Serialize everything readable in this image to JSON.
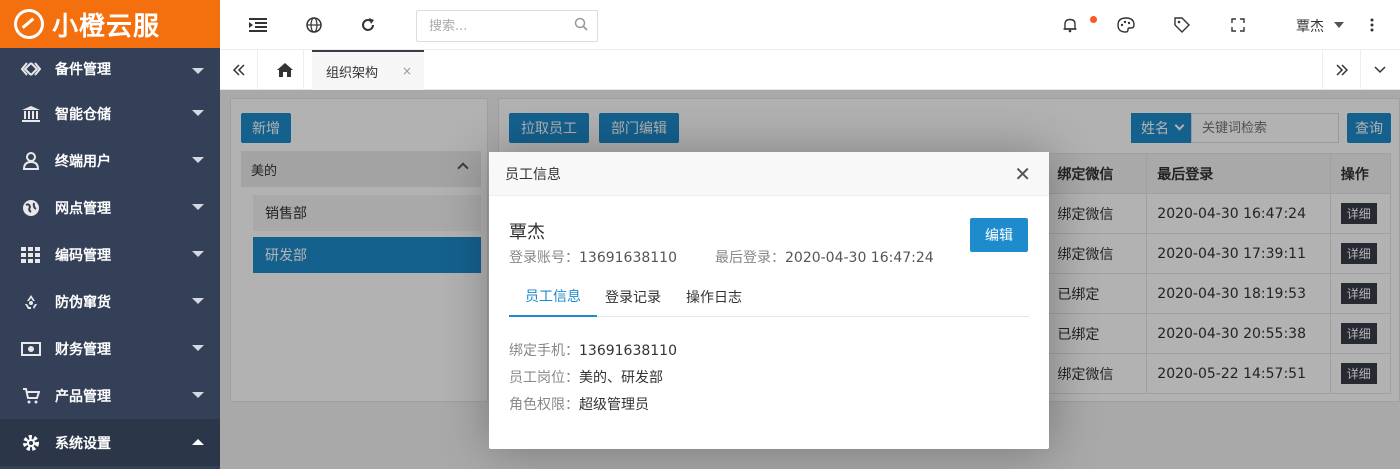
{
  "brand": {
    "name": "小橙云服",
    "color": "#f4700e"
  },
  "sidebar": {
    "items": [
      {
        "label": "备件管理",
        "icon": "arrows-icon",
        "expanded": false
      },
      {
        "label": "智能仓储",
        "icon": "bank-icon",
        "expanded": false
      },
      {
        "label": "终端用户",
        "icon": "user-icon",
        "expanded": false
      },
      {
        "label": "网点管理",
        "icon": "globe-icon",
        "expanded": false
      },
      {
        "label": "编码管理",
        "icon": "grid-icon",
        "expanded": false
      },
      {
        "label": "防伪窜货",
        "icon": "recycle-icon",
        "expanded": false
      },
      {
        "label": "财务管理",
        "icon": "money-icon",
        "expanded": false
      },
      {
        "label": "产品管理",
        "icon": "cart-icon",
        "expanded": false
      },
      {
        "label": "系统设置",
        "icon": "gear-icon",
        "expanded": true
      }
    ]
  },
  "topbar": {
    "search_placeholder": "搜索...",
    "user_name": "覃杰",
    "has_notification": true
  },
  "tabs": {
    "active_label": "组织架构",
    "close_glyph": "×"
  },
  "left_panel": {
    "add_button": "新增",
    "parent_dept": "美的",
    "children": [
      "销售部",
      "研发部"
    ],
    "selected_child": "研发部"
  },
  "right_panel": {
    "pull_button": "拉取员工",
    "dept_edit_button": "部门编辑",
    "filter_field": "姓名",
    "keyword_placeholder": "关键词检索",
    "query_button": "查询",
    "columns": [
      "绑定微信",
      "最后登录",
      "操作"
    ],
    "rows": [
      {
        "wechat": "绑定微信",
        "last_login": "2020-04-30 16:47:24",
        "action": "详细"
      },
      {
        "wechat": "绑定微信",
        "last_login": "2020-04-30 17:39:11",
        "action": "详细"
      },
      {
        "wechat": "已绑定",
        "last_login": "2020-04-30 18:19:53",
        "action": "详细"
      },
      {
        "wechat": "已绑定",
        "last_login": "2020-04-30 20:55:38",
        "action": "详细"
      },
      {
        "wechat": "绑定微信",
        "last_login": "2020-05-22 14:57:51",
        "action": "详细"
      }
    ]
  },
  "dialog": {
    "title": "员工信息",
    "close_glyph": "✕",
    "employee_name": "覃杰",
    "account_label": "登录账号：",
    "account_value": "13691638110",
    "last_login_label": "最后登录：",
    "last_login_value": "2020-04-30 16:47:24",
    "edit_button": "编辑",
    "tabs": [
      "员工信息",
      "登录记录",
      "操作日志"
    ],
    "active_tab": "员工信息",
    "fields": [
      {
        "label": "绑定手机：",
        "value": "13691638110"
      },
      {
        "label": "员工岗位：",
        "value": "美的、研发部"
      },
      {
        "label": "角色权限：",
        "value": "超级管理员"
      }
    ]
  },
  "colors": {
    "primary": "#1e8bcc",
    "sidebar_bg": "#344058",
    "dark_button": "#393d49",
    "notification_dot": "#ff5722"
  }
}
